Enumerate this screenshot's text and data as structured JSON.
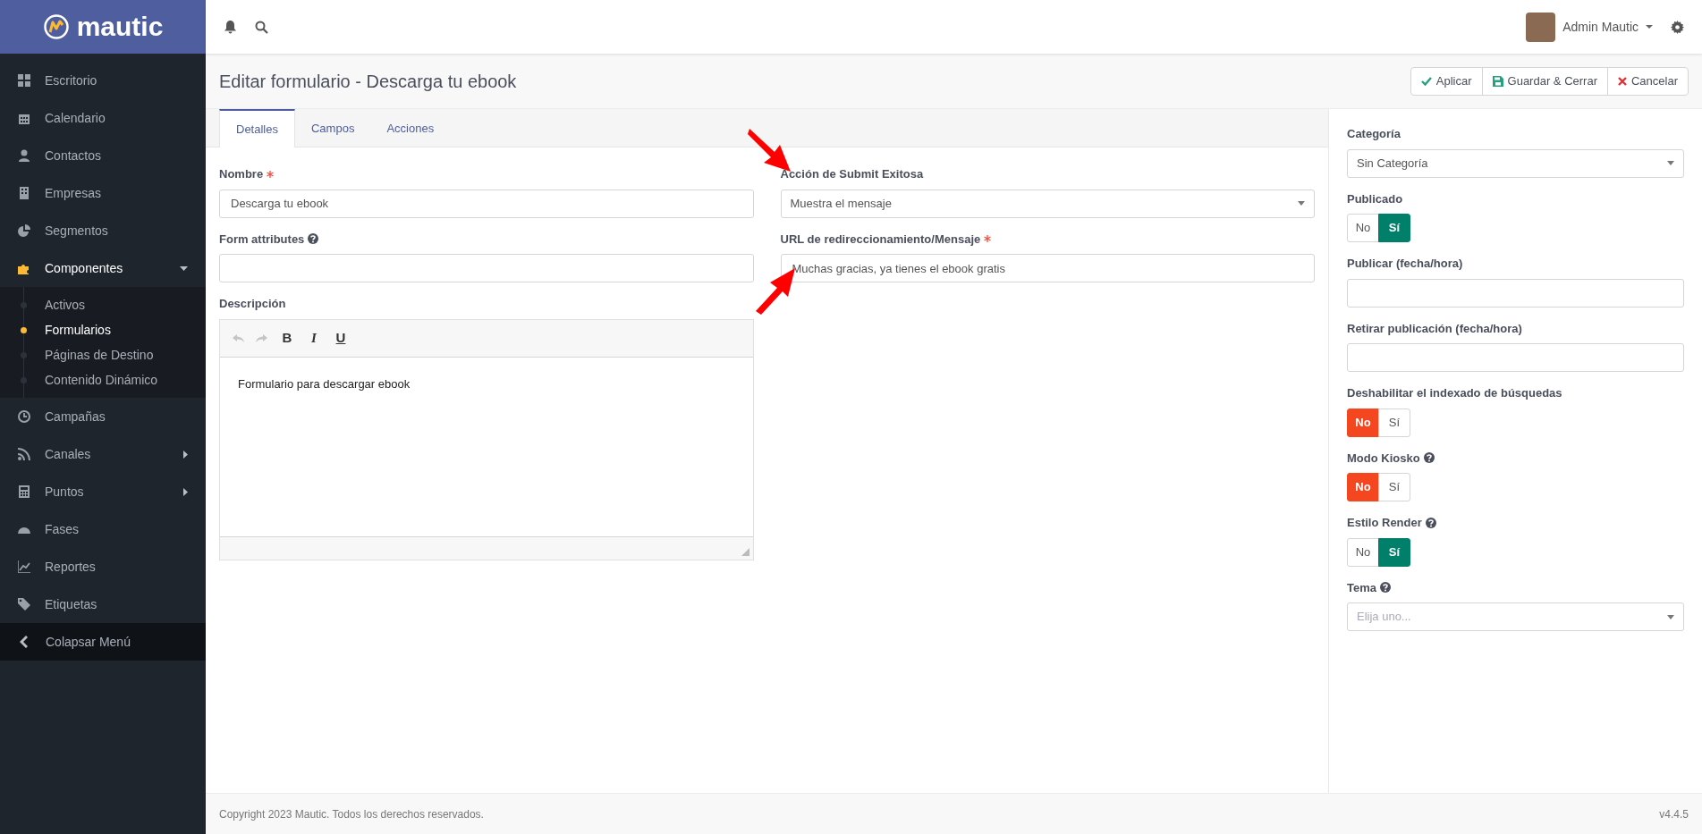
{
  "brand": {
    "name": "mautic"
  },
  "topbar": {
    "user": "Admin Mautic"
  },
  "sidebar": {
    "items": [
      {
        "label": "Escritorio",
        "selected": false
      },
      {
        "label": "Calendario",
        "selected": false
      },
      {
        "label": "Contactos",
        "selected": false
      },
      {
        "label": "Empresas",
        "selected": false
      },
      {
        "label": "Segmentos",
        "selected": false
      },
      {
        "label": "Componentes",
        "selected": true,
        "expanded": true,
        "children": [
          {
            "label": "Activos",
            "selected": false
          },
          {
            "label": "Formularios",
            "selected": true
          },
          {
            "label": "Páginas de Destino",
            "selected": false
          },
          {
            "label": "Contenido Dinámico",
            "selected": false
          }
        ]
      },
      {
        "label": "Campañas",
        "selected": false
      },
      {
        "label": "Canales",
        "selected": false,
        "expanded": false
      },
      {
        "label": "Puntos",
        "selected": false,
        "expanded": false
      },
      {
        "label": "Fases",
        "selected": false
      },
      {
        "label": "Reportes",
        "selected": false
      },
      {
        "label": "Etiquetas",
        "selected": false
      }
    ],
    "collapse": "Colapsar Menú"
  },
  "page": {
    "title": "Editar formulario - Descarga tu ebook",
    "buttons": [
      "Aplicar",
      "Guardar & Cerrar",
      "Cancelar"
    ]
  },
  "tabs": [
    {
      "label": "Detalles",
      "selected": true
    },
    {
      "label": "Campos",
      "selected": false
    },
    {
      "label": "Acciones",
      "selected": false
    }
  ],
  "left_fields": [
    {
      "kind": "input",
      "label": "Nombre",
      "required": true,
      "value": "Descarga tu ebook"
    },
    {
      "kind": "input",
      "label": "Form attributes",
      "help": true
    },
    {
      "kind": "editor",
      "label": "Descripción",
      "toolbar": [
        {
          "kind": "undo",
          "disabled": true
        },
        {
          "kind": "redo",
          "disabled": true
        },
        {
          "kind": "bold",
          "label": "B"
        },
        {
          "kind": "italic",
          "label": "I"
        },
        {
          "kind": "underline",
          "label": "U"
        }
      ],
      "content": "Formulario para descargar ebook"
    }
  ],
  "middle_fields": [
    {
      "kind": "select",
      "label": "Acción de Submit Exitosa",
      "value": "Muestra el mensaje"
    },
    {
      "kind": "input",
      "label": "URL de redireccionamiento/Mensaje",
      "required": true,
      "value": "Muchas gracias, ya tienes el ebook gratis"
    }
  ],
  "right_fields": [
    {
      "kind": "select",
      "label": "Categoría",
      "value": "Sin Categoría"
    },
    {
      "kind": "toggle",
      "label": "Publicado",
      "options": [
        {
          "label": "No",
          "selected": false
        },
        {
          "label": "Sí",
          "selected": true
        }
      ]
    },
    {
      "kind": "input",
      "label": "Publicar (fecha/hora)"
    },
    {
      "kind": "input",
      "label": "Retirar publicación (fecha/hora)"
    },
    {
      "kind": "toggle",
      "label": "Deshabilitar el indexado de búsquedas",
      "options": [
        {
          "label": "No",
          "selected": true
        },
        {
          "label": "Sí",
          "selected": false
        }
      ]
    },
    {
      "kind": "toggle",
      "label": "Modo Kiosko",
      "help": true,
      "options": [
        {
          "label": "No",
          "selected": true
        },
        {
          "label": "Sí",
          "selected": false
        }
      ]
    },
    {
      "kind": "toggle",
      "label": "Estilo Render",
      "help": true,
      "options": [
        {
          "label": "No",
          "selected": false
        },
        {
          "label": "Sí",
          "selected": true
        }
      ]
    },
    {
      "kind": "select",
      "label": "Tema",
      "help": true,
      "placeholder": "Elija uno..."
    }
  ],
  "footer": {
    "copyright": "Copyright 2023 Mautic. Todos los derechos reservados.",
    "version": "v4.4.5"
  }
}
